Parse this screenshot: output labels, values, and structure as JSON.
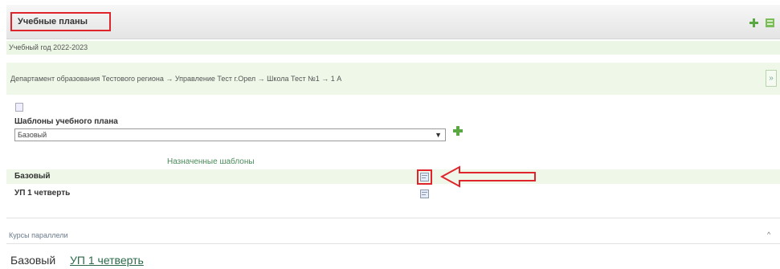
{
  "header": {
    "title": "Учебные планы"
  },
  "school_year": "Учебный год 2022-2023",
  "org_path": "Департамент образования Тестового региона → Управление Тест г.Орел → Школа Тест №1 → 1 А",
  "org_path_button": "»",
  "templates": {
    "label": "Шаблоны учебного плана",
    "selected": "Базовый"
  },
  "assigned": {
    "title": "Назначенные шаблоны",
    "rows": [
      {
        "label": "Базовый"
      },
      {
        "label": "УП 1 четверть"
      }
    ]
  },
  "courses": {
    "title": "Курсы параллели",
    "collapse_glyph": "^",
    "tabs": [
      {
        "label": "Базовый"
      },
      {
        "label": "УП 1 четверть"
      }
    ]
  },
  "colors": {
    "highlight": "#e0242c",
    "green_bg": "#eef7e8",
    "green_icon": "#5aa842"
  }
}
